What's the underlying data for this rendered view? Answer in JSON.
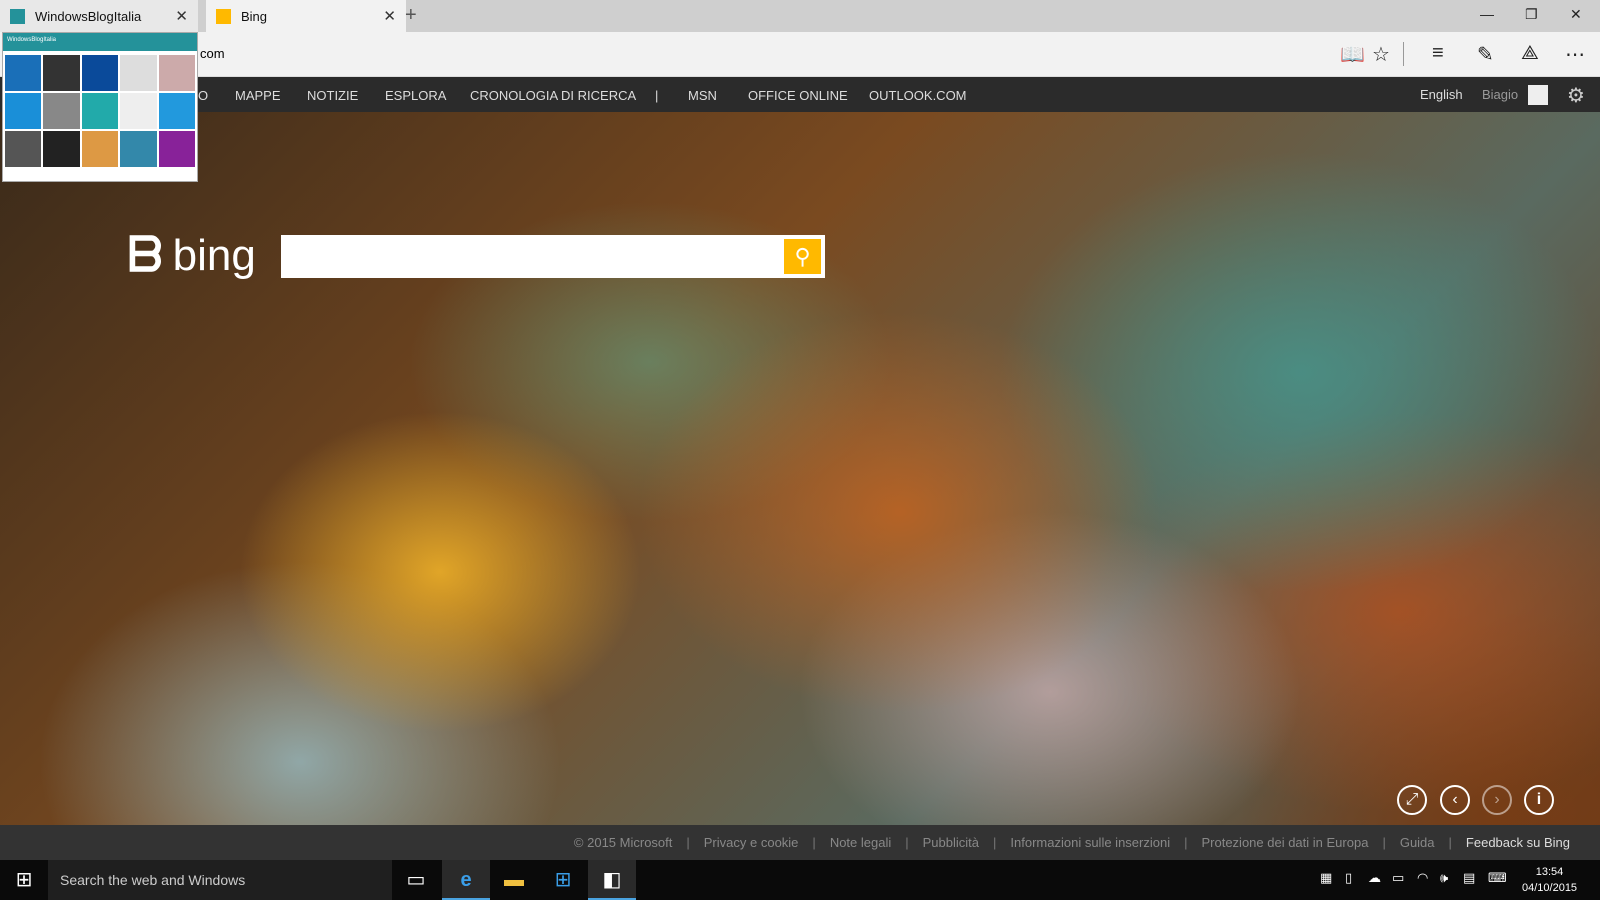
{
  "tabs": [
    {
      "title": "WindowsBlogItalia",
      "favicon": "windowsblogitalia-icon"
    },
    {
      "title": "Bing",
      "favicon": "bing-icon",
      "active": true
    }
  ],
  "address": {
    "value": "com"
  },
  "preview": {
    "title": "WindowsBlogItalia"
  },
  "bing_nav": {
    "items": [
      "MAPPE",
      "NOTIZIE",
      "ESPLORA",
      "CRONOLOGIA DI RICERCA",
      "|",
      "MSN",
      "OFFICE ONLINE",
      "OUTLOOK.COM"
    ],
    "partial_item": "O",
    "language": "English",
    "user": "Biagio"
  },
  "logo": "bing",
  "search": {
    "value": "",
    "accent": "#ffb900"
  },
  "footer": {
    "items": [
      "© 2015 Microsoft",
      "Privacy e cookie",
      "Note legali",
      "Pubblicità",
      "Informazioni sulle inserzioni",
      "Protezione dei dati in Europa",
      "Guida",
      "Feedback su Bing"
    ]
  },
  "taskbar": {
    "search_placeholder": "Search the web and Windows",
    "time": "13:54",
    "date": "04/10/2015"
  }
}
